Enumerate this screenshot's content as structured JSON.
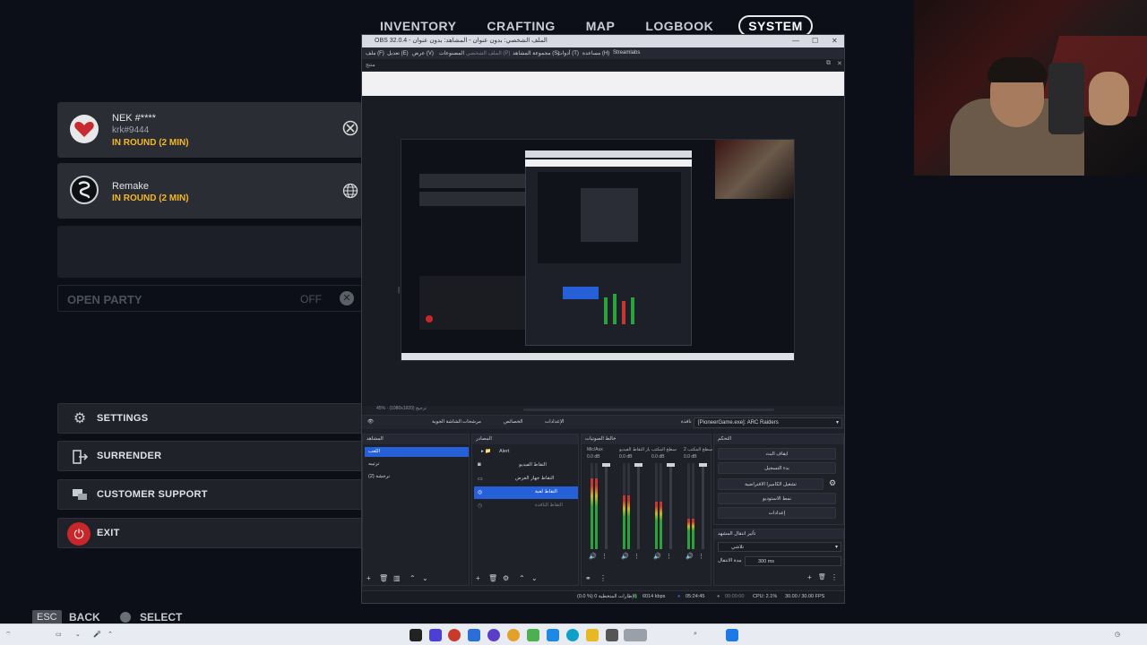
{
  "game": {
    "tabs": [
      "INVENTORY",
      "CRAFTING",
      "MAP",
      "LOGBOOK",
      "SYSTEM"
    ],
    "active_tab": "SYSTEM",
    "party": [
      {
        "name": "NEK #****",
        "sub": "krk#9444",
        "status": "IN ROUND (2 MIN)",
        "platform_icon": "xbox-icon"
      },
      {
        "name": "Remake",
        "status": "IN ROUND (2 MIN)",
        "platform_icon": "globe-icon"
      }
    ],
    "open_party": {
      "label": "OPEN PARTY",
      "value": "OFF"
    },
    "menu": {
      "settings": "SETTINGS",
      "surrender": "SURRENDER",
      "support": "CUSTOMER SUPPORT",
      "exit": "EXIT"
    },
    "hints": {
      "esc_key": "ESC",
      "back": "BACK",
      "select": "SELECT"
    }
  },
  "obs": {
    "title": "OBS 32.0.4 - الملف الشخصي: بدون عنوان - المشاهد: بدون عنوان",
    "menu": [
      "ملف (F)",
      "تعديل (E)",
      "عرض (V)",
      "المصنوعات",
      "الملف الشخصي (P)",
      "مجموعة المشاهد (S)",
      "أدوات (T)",
      "مساعدة (H)",
      "Streamlabs"
    ],
    "dock_label": "منتج",
    "zoom_text": "45% · (1080x1920) ترجيح",
    "controls_bar": {
      "scene_label": "الشاشة الجوية",
      "filters": "مرشحات",
      "properties": "الخصائص",
      "settings": "الإعدادات",
      "window_label": "نافذة",
      "source_value": "[PioneerGame.exe]: ARC Raiders"
    },
    "scenes": {
      "title": "المشاهد",
      "items": [
        "اللعب",
        "ترتيبه",
        "نرجشة (2)"
      ],
      "selected": 0
    },
    "sources": {
      "title": "المصادر",
      "items": [
        "Alert",
        "التقاط الفيديو",
        "التقاط جهاز العرض",
        "التقاط لعبة",
        "التقاط النافذة"
      ],
      "selected": 3
    },
    "mixer": {
      "title": "خالط الصوتيات",
      "channels": [
        {
          "name": "Mic/Aux",
          "db": "0.0 dB",
          "level": 0.82
        },
        {
          "name": "جهاز التقاط الفيديو",
          "db": "0.0 dB",
          "level": 0.62
        },
        {
          "name": "سطح المكتب",
          "db": "0.0 dB",
          "level": 0.55
        },
        {
          "name": "سطح المكتب 2",
          "db": "0.0 dB",
          "level": 0.35
        }
      ]
    },
    "controls": {
      "title": "التحكم",
      "buttons": [
        "ايقاف البث",
        "بدء التسجيل",
        "تشغيل الكاميرا الافتراضية",
        "نمط الاستوديو",
        "إعدادات"
      ]
    },
    "transitions": {
      "title": "تأثير انتقال المشهد",
      "type": "تلاشي",
      "duration_label": "مدة الانتقال",
      "duration": "300 ms"
    },
    "status": {
      "dropped": "(0.0 %) 0 الإطارات المتخطية",
      "bitrate": "6014 kbps",
      "time": "05:24:45",
      "rec_time": "00:00:00",
      "cpu": "CPU: 2.1%",
      "fps": "30.00 / 30.00 FPS"
    }
  },
  "colors": {
    "accent_blue": "#2560d8",
    "status_yellow": "#f3b72a",
    "exit_red": "#c8262a"
  }
}
